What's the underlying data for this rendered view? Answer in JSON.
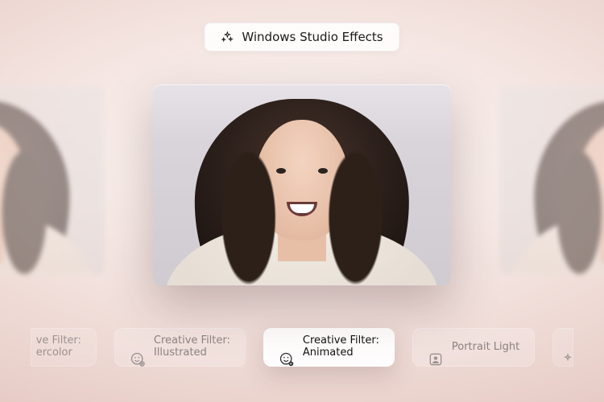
{
  "header": {
    "title": "Windows Studio Effects",
    "icon": "sparkle-icon"
  },
  "preview": {
    "current_effect": "Creative Filter: Animated"
  },
  "filters": [
    {
      "id": "watercolor",
      "label": "Creative Filter:\nWatercolor",
      "label_visible": "ve Filter:\nercolor",
      "icon": "droplet-icon",
      "selected": false,
      "partial": "left"
    },
    {
      "id": "illustrated",
      "label": "Creative Filter:\nIllustrated",
      "icon": "smiley-plus-icon",
      "selected": false
    },
    {
      "id": "animated",
      "label": "Creative Filter:\nAnimated",
      "icon": "smiley-play-icon",
      "selected": true
    },
    {
      "id": "portrait",
      "label": "Portrait Light",
      "icon": "portrait-icon",
      "selected": false
    },
    {
      "id": "next",
      "label": "",
      "icon": "sparkle-icon",
      "selected": false,
      "partial": "right"
    }
  ]
}
